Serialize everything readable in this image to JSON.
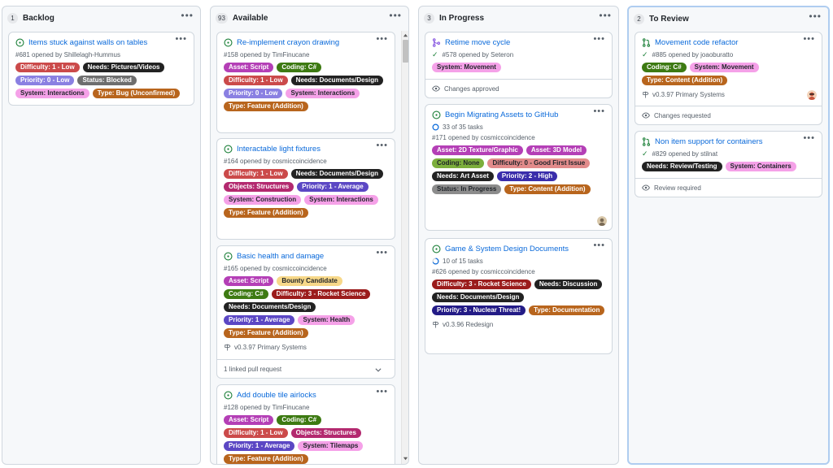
{
  "columns": [
    {
      "count": "1",
      "title": "Backlog",
      "cards": [
        {
          "state": "open",
          "title": "Items stuck against walls on tables",
          "meta": "#681 opened by Shillelagh-Hummus",
          "labels": [
            {
              "text": "Difficulty: 1 - Low",
              "bg": "#cb4a4a",
              "fg": "#ffffff"
            },
            {
              "text": "Needs: Pictures/Videos",
              "bg": "#222222",
              "fg": "#ffffff"
            },
            {
              "text": "Priority: 0 - Low",
              "bg": "#8a80e2",
              "fg": "#ffffff"
            },
            {
              "text": "Status: Blocked",
              "bg": "#6e6e6e",
              "fg": "#ffffff"
            },
            {
              "text": "System: Interactions",
              "bg": "#f5a1e8",
              "fg": "#1f2328"
            },
            {
              "text": "Type: Bug (Unconfirmed)",
              "bg": "#b8651d",
              "fg": "#ffffff"
            }
          ]
        }
      ]
    },
    {
      "count": "93",
      "title": "Available",
      "cards": [
        {
          "state": "open",
          "title": "Re-implement crayon drawing",
          "meta": "#158 opened by TimFinucane",
          "labels": [
            {
              "text": "Asset: Script",
              "bg": "#b43fb6",
              "fg": "#ffffff"
            },
            {
              "text": "Coding: C#",
              "bg": "#3d7a12",
              "fg": "#ffffff"
            },
            {
              "text": "Difficulty: 1 - Low",
              "bg": "#cb4a4a",
              "fg": "#ffffff"
            },
            {
              "text": "Needs: Documents/Design",
              "bg": "#222222",
              "fg": "#ffffff"
            },
            {
              "text": "Priority: 0 - Low",
              "bg": "#8a80e2",
              "fg": "#ffffff"
            },
            {
              "text": "System: Interactions",
              "bg": "#f5a1e8",
              "fg": "#1f2328"
            },
            {
              "text": "Type: Feature (Addition)",
              "bg": "#b8651d",
              "fg": "#ffffff"
            }
          ]
        },
        {
          "state": "open",
          "title": "Interactable light fixtures",
          "meta": "#164 opened by cosmiccoincidence",
          "labels": [
            {
              "text": "Difficulty: 1 - Low",
              "bg": "#cb4a4a",
              "fg": "#ffffff"
            },
            {
              "text": "Needs: Documents/Design",
              "bg": "#222222",
              "fg": "#ffffff"
            },
            {
              "text": "Objects: Structures",
              "bg": "#b3296f",
              "fg": "#ffffff"
            },
            {
              "text": "Priority: 1 - Average",
              "bg": "#5b47c4",
              "fg": "#ffffff"
            },
            {
              "text": "System: Construction",
              "bg": "#f5a1e8",
              "fg": "#1f2328"
            },
            {
              "text": "System: Interactions",
              "bg": "#f5a1e8",
              "fg": "#1f2328"
            },
            {
              "text": "Type: Feature (Addition)",
              "bg": "#b8651d",
              "fg": "#ffffff"
            }
          ]
        },
        {
          "state": "open",
          "title": "Basic health and damage",
          "meta": "#165 opened by cosmiccoincidence",
          "labels": [
            {
              "text": "Asset: Script",
              "bg": "#b43fb6",
              "fg": "#ffffff"
            },
            {
              "text": "Bounty Candidate",
              "bg": "#f7d889",
              "fg": "#1f2328"
            },
            {
              "text": "Coding: C#",
              "bg": "#3d7a12",
              "fg": "#ffffff"
            },
            {
              "text": "Difficulty: 3 - Rocket Science",
              "bg": "#9b1c1c",
              "fg": "#ffffff"
            },
            {
              "text": "Needs: Documents/Design",
              "bg": "#222222",
              "fg": "#ffffff"
            },
            {
              "text": "Priority: 1 - Average",
              "bg": "#5b47c4",
              "fg": "#ffffff"
            },
            {
              "text": "System: Health",
              "bg": "#f5a1e8",
              "fg": "#1f2328"
            },
            {
              "text": "Type: Feature (Addition)",
              "bg": "#b8651d",
              "fg": "#ffffff"
            }
          ],
          "milestone": "v0.3.97 Primary Systems",
          "footer": "1 linked pull request"
        },
        {
          "state": "open",
          "title": "Add double tile airlocks",
          "meta": "#128 opened by TimFinucane",
          "labels": [
            {
              "text": "Asset: Script",
              "bg": "#b43fb6",
              "fg": "#ffffff"
            },
            {
              "text": "Coding: C#",
              "bg": "#3d7a12",
              "fg": "#ffffff"
            },
            {
              "text": "Difficulty: 1 - Low",
              "bg": "#cb4a4a",
              "fg": "#ffffff"
            },
            {
              "text": "Objects: Structures",
              "bg": "#b3296f",
              "fg": "#ffffff"
            },
            {
              "text": "Priority: 1 - Average",
              "bg": "#5b47c4",
              "fg": "#ffffff"
            },
            {
              "text": "System: Tilemaps",
              "bg": "#f5a1e8",
              "fg": "#1f2328"
            },
            {
              "text": "Type: Feature (Addition)",
              "bg": "#b8651d",
              "fg": "#ffffff"
            }
          ]
        }
      ]
    },
    {
      "count": "3",
      "title": "In Progress",
      "cards": [
        {
          "state": "merged",
          "title": "Retime move cycle",
          "meta": "#578 opened by Seteron",
          "labels": [
            {
              "text": "System: Movement",
              "bg": "#f5a1e8",
              "fg": "#1f2328"
            }
          ],
          "footer": "Changes approved"
        },
        {
          "state": "open",
          "title": "Begin Migrating Assets to GitHub",
          "tasks": "33 of 35 tasks",
          "meta": "#171 opened by cosmiccoincidence",
          "labels": [
            {
              "text": "Asset: 2D Texture/Graphic",
              "bg": "#b43fb6",
              "fg": "#ffffff"
            },
            {
              "text": "Asset: 3D Model",
              "bg": "#b43fb6",
              "fg": "#ffffff"
            },
            {
              "text": "Coding: None",
              "bg": "#7cae3c",
              "fg": "#1f2328"
            },
            {
              "text": "Difficulty: 0 - Good First Issue",
              "bg": "#e28b8b",
              "fg": "#1f2328"
            },
            {
              "text": "Needs: Art Asset",
              "bg": "#222222",
              "fg": "#ffffff"
            },
            {
              "text": "Priority: 2 - High",
              "bg": "#3a2dab",
              "fg": "#ffffff"
            },
            {
              "text": "Status: In Progress",
              "bg": "#8c8c8c",
              "fg": "#1f2328"
            },
            {
              "text": "Type: Content (Addition)",
              "bg": "#b8651d",
              "fg": "#ffffff"
            }
          ]
        },
        {
          "state": "open",
          "title": "Game & System Design Documents",
          "tasks": "10 of 15 tasks",
          "meta": "#626 opened by cosmiccoincidence",
          "labels": [
            {
              "text": "Difficulty: 3 - Rocket Science",
              "bg": "#9b1c1c",
              "fg": "#ffffff"
            },
            {
              "text": "Needs: Discussion",
              "bg": "#222222",
              "fg": "#ffffff"
            },
            {
              "text": "Needs: Documents/Design",
              "bg": "#222222",
              "fg": "#ffffff"
            },
            {
              "text": "Priority: 3 - Nuclear Threat!",
              "bg": "#231b86",
              "fg": "#ffffff"
            },
            {
              "text": "Type: Documentation",
              "bg": "#b8651d",
              "fg": "#ffffff"
            }
          ],
          "milestone": "v0.3.96 Redesign"
        }
      ]
    },
    {
      "count": "2",
      "title": "To Review",
      "cards": [
        {
          "state": "pr",
          "title": "Movement code refactor",
          "meta": "#885 opened by joaoburatto",
          "labels": [
            {
              "text": "Coding: C#",
              "bg": "#3d7a12",
              "fg": "#ffffff"
            },
            {
              "text": "System: Movement",
              "bg": "#f5a1e8",
              "fg": "#1f2328"
            },
            {
              "text": "Type: Content (Addition)",
              "bg": "#b8651d",
              "fg": "#ffffff"
            }
          ],
          "milestone": "v0.3.97 Primary Systems",
          "footer": "Changes requested"
        },
        {
          "state": "pr",
          "title": "Non item support for containers",
          "meta": "#829 opened by stilnat",
          "labels": [
            {
              "text": "Needs: Review/Testing",
              "bg": "#222222",
              "fg": "#ffffff"
            },
            {
              "text": "System: Containers",
              "bg": "#f5a1e8",
              "fg": "#1f2328"
            }
          ],
          "footer": "Review required"
        }
      ]
    }
  ]
}
